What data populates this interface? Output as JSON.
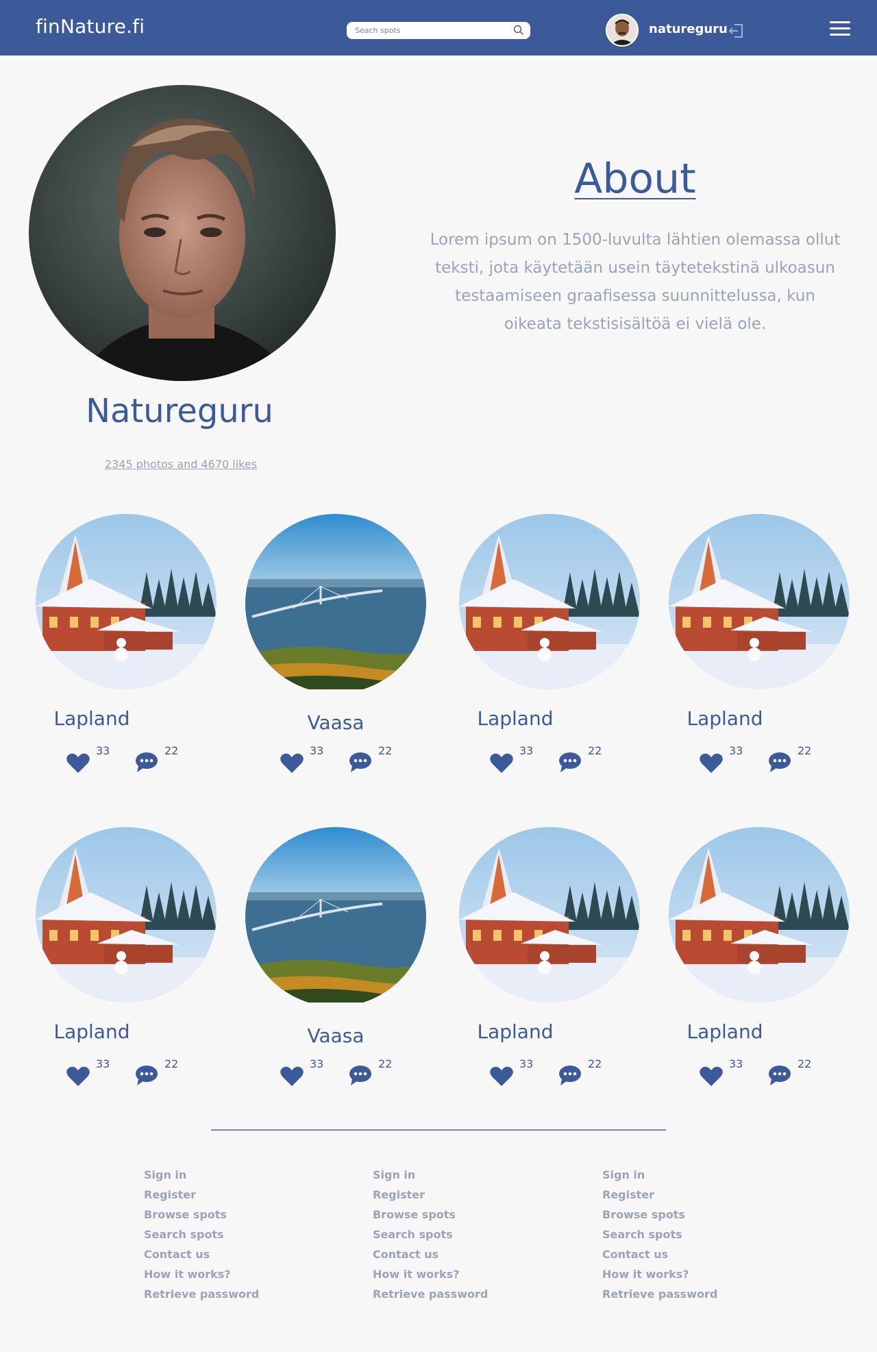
{
  "header": {
    "logo": "finNature.fi",
    "search_placeholder": "Seach spots",
    "username": "natureguru",
    "icons": {
      "search": "search-icon",
      "logout": "logout-icon",
      "menu": "hamburger-menu-icon"
    }
  },
  "profile": {
    "name": "Natureguru",
    "stats": "2345 photos and 4670 likes"
  },
  "about": {
    "title": "About",
    "text": "Lorem ipsum on 1500-luvulta lähtien olemassa ollut teksti, jota käytetään usein täytetekstinä ulkoasun testaamiseen graafisessa suunnittelussa, kun oikeata tekstisisältöä ei vielä ole."
  },
  "spots": [
    {
      "title": "Lapland",
      "image": "lapland-winter-house",
      "likes": "33",
      "comments": "22"
    },
    {
      "title": "Vaasa",
      "image": "vaasa-bridge-aerial",
      "likes": "33",
      "comments": "22"
    },
    {
      "title": "Lapland",
      "image": "lapland-winter-house",
      "likes": "33",
      "comments": "22"
    },
    {
      "title": "Lapland",
      "image": "lapland-winter-house",
      "likes": "33",
      "comments": "22"
    },
    {
      "title": "Lapland",
      "image": "lapland-winter-house",
      "likes": "33",
      "comments": "22"
    },
    {
      "title": "Vaasa",
      "image": "vaasa-bridge-aerial",
      "likes": "33",
      "comments": "22"
    },
    {
      "title": "Lapland",
      "image": "lapland-winter-house",
      "likes": "33",
      "comments": "22"
    },
    {
      "title": "Lapland",
      "image": "lapland-winter-house",
      "likes": "33",
      "comments": "22"
    }
  ],
  "footer": {
    "columns": [
      [
        "Sign in",
        "Register",
        "Browse spots",
        "Search spots",
        "Contact us",
        "How it works?",
        "Retrieve password"
      ],
      [
        "Sign in",
        "Register",
        "Browse spots",
        "Search spots",
        "Contact us",
        "How it works?",
        "Retrieve password"
      ],
      [
        "Sign in",
        "Register",
        "Browse spots",
        "Search spots",
        "Contact us",
        "How it works?",
        "Retrieve password"
      ]
    ]
  },
  "colors": {
    "brand": "#3c5a99",
    "muted_text": "#9aa3b8",
    "background": "#f7f7f7"
  }
}
